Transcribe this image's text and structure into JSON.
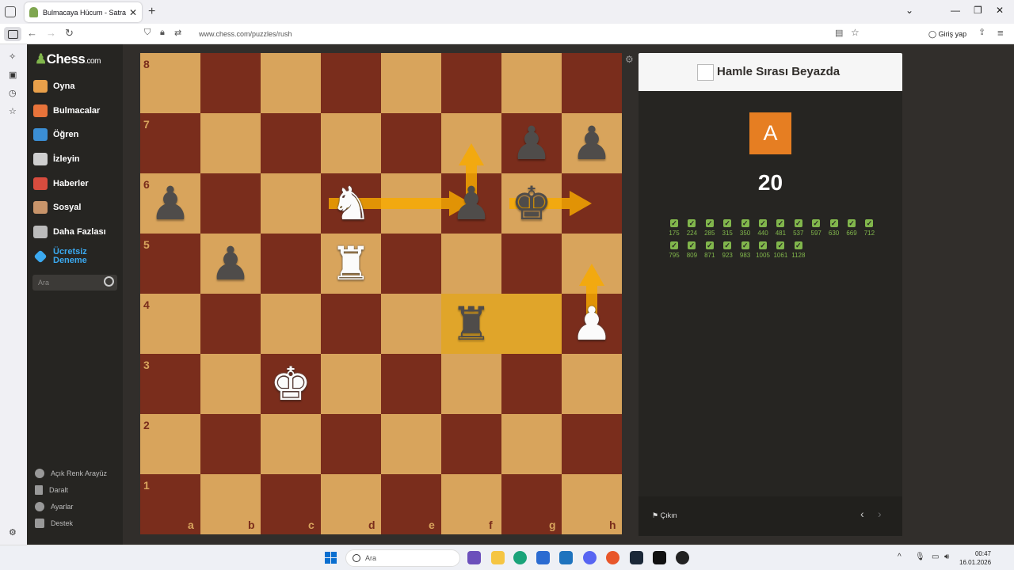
{
  "browser": {
    "tab_title": "Bulmacaya Hücum - Satranç Bu",
    "url": "www.chess.com/puzzles/rush",
    "login_label": "Giriş yap"
  },
  "sidebar": {
    "logo": "Chess",
    "logo_suffix": ".com",
    "items": [
      {
        "label": "Oyna",
        "icon": "pawn-play-icon",
        "color": "#e9a04a"
      },
      {
        "label": "Bulmacalar",
        "icon": "puzzle-icon",
        "color": "#e8733a"
      },
      {
        "label": "Öğren",
        "icon": "learn-cube-icon",
        "color": "#3b8ed4"
      },
      {
        "label": "İzleyin",
        "icon": "binoculars-icon",
        "color": "#cfcfcf"
      },
      {
        "label": "Haberler",
        "icon": "news-icon",
        "color": "#d84c3e"
      },
      {
        "label": "Sosyal",
        "icon": "social-icon",
        "color": "#c8946a"
      },
      {
        "label": "Daha Fazlası",
        "icon": "more-dots-icon",
        "color": "#bbbbbb"
      }
    ],
    "trial_label": "Ücretsiz Deneme",
    "search_placeholder": "Ara",
    "bottom": [
      "Açık Renk Arayüz",
      "Daralt",
      "Ayarlar",
      "Destek"
    ]
  },
  "board": {
    "ranks": [
      "8",
      "7",
      "6",
      "5",
      "4",
      "3",
      "2",
      "1"
    ],
    "files": [
      "a",
      "b",
      "c",
      "d",
      "e",
      "f",
      "g",
      "h"
    ],
    "highlighted_squares": [
      "f4",
      "g4"
    ],
    "pieces": [
      {
        "square": "g7",
        "glyph": "♟",
        "color": "b",
        "name": "black-pawn"
      },
      {
        "square": "h7",
        "glyph": "♟",
        "color": "b",
        "name": "black-pawn"
      },
      {
        "square": "a6",
        "glyph": "♟",
        "color": "b",
        "name": "black-pawn"
      },
      {
        "square": "d6",
        "glyph": "♞",
        "color": "w",
        "name": "white-knight"
      },
      {
        "square": "f6",
        "glyph": "♟",
        "color": "b",
        "name": "black-pawn"
      },
      {
        "square": "g6",
        "glyph": "♚",
        "color": "b",
        "name": "black-king"
      },
      {
        "square": "b5",
        "glyph": "♟",
        "color": "b",
        "name": "black-pawn"
      },
      {
        "square": "d5",
        "glyph": "♜",
        "color": "w",
        "name": "white-rook"
      },
      {
        "square": "f4",
        "glyph": "♜",
        "color": "b",
        "name": "black-rook"
      },
      {
        "square": "h4",
        "glyph": "♟",
        "color": "w",
        "name": "white-pawn"
      },
      {
        "square": "c3",
        "glyph": "♚",
        "color": "w",
        "name": "white-king"
      }
    ],
    "arrows": [
      {
        "from": "d6",
        "to": "f6"
      },
      {
        "from": "f6",
        "to": "f7"
      },
      {
        "from": "g6",
        "to": "h6"
      },
      {
        "from": "h4",
        "to": "h5"
      }
    ],
    "arrow_color": "#f8aa00"
  },
  "panel": {
    "title": "Hamle Sırası Beyazda",
    "avatar_letter": "A",
    "avatar_color": "#e67e22",
    "score": "20",
    "check_mark": "✓",
    "solved": [
      "175",
      "224",
      "285",
      "315",
      "350",
      "440",
      "481",
      "537",
      "597",
      "630",
      "669",
      "712",
      "795",
      "809",
      "871",
      "923",
      "983",
      "1005",
      "1061",
      "1128"
    ],
    "quit_label": "Çıkın"
  },
  "taskbar": {
    "search_placeholder": "Ara",
    "time": "00:47",
    "date": "16.01.2026"
  }
}
